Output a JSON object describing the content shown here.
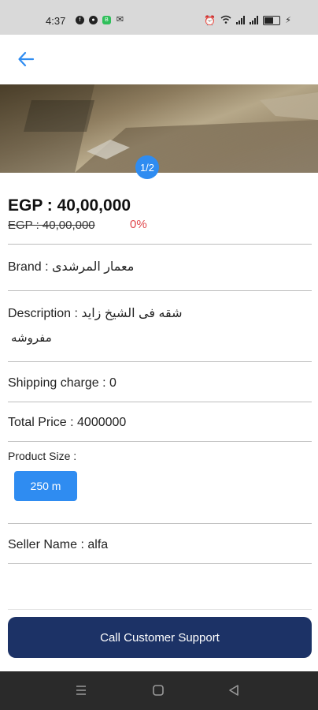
{
  "status_bar": {
    "time": "4:37",
    "left_icons": [
      "facebook-icon",
      "record-icon",
      "app-icon",
      "mail-icon"
    ],
    "right_icons": [
      "alarm-icon",
      "wifi-icon",
      "signal-icon",
      "battery-icon"
    ]
  },
  "app_bar": {
    "back_icon": "arrow-left-icon",
    "accent": "#2f8cf1"
  },
  "gallery": {
    "pager": "1/2"
  },
  "product": {
    "price": "EGP : 40,00,000",
    "old_price": "EGP : 40,00,000",
    "discount": "0%",
    "brand": "Brand : معمار المرشدى",
    "description": "Description : شقه فى الشيخ زايد",
    "description_line2": "مفروشه",
    "shipping": "Shipping charge : 0",
    "total": "Total Price : 4000000",
    "size_label": "Product Size :",
    "size_option": "250 m",
    "seller": "Seller Name : alfa"
  },
  "cta": {
    "label": "Call Customer Support",
    "color": "#1c3266"
  },
  "nav_bar": {
    "buttons": [
      "menu-icon",
      "home-icon",
      "back-icon"
    ]
  }
}
